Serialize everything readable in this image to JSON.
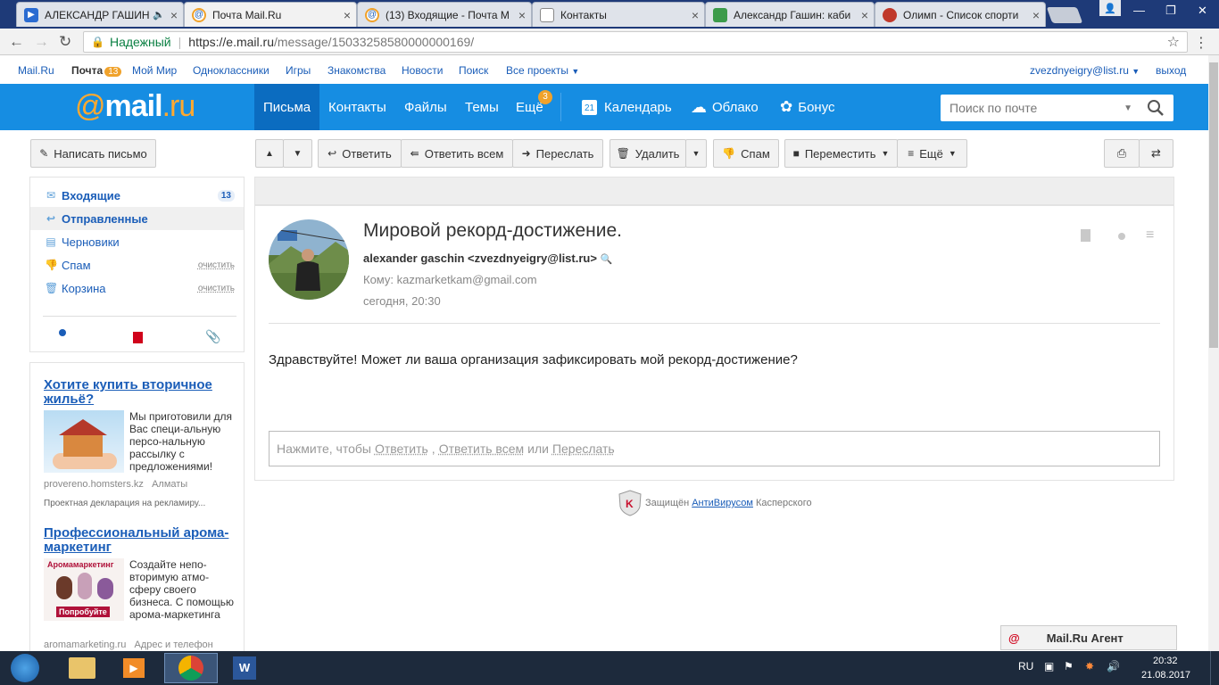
{
  "browser": {
    "tabs": [
      {
        "title": "АЛЕКСАНДР ГАШИН",
        "favicon": "play-icon"
      },
      {
        "title": "Почта Mail.Ru",
        "favicon": "mail-ru-icon"
      },
      {
        "title": "(13) Входящие - Почта М",
        "favicon": "mail-ru-icon"
      },
      {
        "title": "Контакты",
        "favicon": "page-icon"
      },
      {
        "title": "Александр Гашин: каби",
        "favicon": "sheet-icon"
      },
      {
        "title": "Олимп - Список спорти",
        "favicon": "olymp-icon"
      }
    ],
    "close_glyph": "×",
    "secure_label": "Надежный",
    "url_host": "https://e.mail.ru",
    "url_path": "/message/15033258580000000169/"
  },
  "portal": {
    "links": [
      "Mail.Ru",
      "Почта",
      "Мой Мир",
      "Одноклассники",
      "Игры",
      "Знакомства",
      "Новости",
      "Поиск",
      "Все проекты"
    ],
    "mail_count": "13",
    "user": "zvezdnyeigry@list.ru",
    "logout": "выход"
  },
  "header": {
    "logo_at": "@",
    "logo_mail": "mail",
    "logo_ru": ".ru",
    "nav": [
      "Письма",
      "Контакты",
      "Файлы",
      "Темы",
      "Ещё"
    ],
    "more_badge": "3",
    "calendar": "Календарь",
    "calendar_day": "21",
    "cloud": "Облако",
    "bonus": "Бонус",
    "search_placeholder": "Поиск по почте"
  },
  "toolbar": {
    "compose": "Написать письмо",
    "reply": "Ответить",
    "reply_all": "Ответить всем",
    "forward": "Переслать",
    "delete": "Удалить",
    "spam": "Спам",
    "move": "Переместить",
    "more": "Ещё"
  },
  "folders": [
    {
      "name": "Входящие",
      "count": "13"
    },
    {
      "name": "Отправленные"
    },
    {
      "name": "Черновики"
    },
    {
      "name": "Спам",
      "action": "очистить"
    },
    {
      "name": "Корзина",
      "action": "очистить"
    }
  ],
  "ads": [
    {
      "title": "Хотите купить вторичное жильё?",
      "text": "Мы приготовили для Вас специ-альную персо-нальную рассылку с предложениями!",
      "domain": "provereno.homsters.kz",
      "location": "Алматы",
      "note": "Проектная декларация на рекламиру..."
    },
    {
      "title": "Профессиональный арома-маркетинг",
      "image_caption": "Аромамаркетинг",
      "image_button": "Попробуйте",
      "text": "Создайте непо-вторимую атмо-сферу своего бизнеса. С помощью арома-маркетинга",
      "domain": "aromamarketing.ru",
      "location": "Адрес и телефон"
    }
  ],
  "message": {
    "subject": "Мировой рекорд-достижение.",
    "from": "alexander gaschin <zvezdnyeigry@list.ru>",
    "to": "Кому: kazmarketkam@gmail.com",
    "date": "сегодня, 20:30",
    "body": "Здравствуйте! Может ли ваша организация зафиксировать мой рекорд-достижение?",
    "reply_prompt": "Нажмите, чтобы",
    "reply_link": "Ответить",
    "reply_all_link": "Ответить всем",
    "or": "или",
    "forward_link": "Переслать"
  },
  "kaspersky": {
    "prefix": "Защищён",
    "link": "АнтиВирусом",
    "suffix": "Касперского"
  },
  "agent": "Mail.Ru Агент",
  "taskbar": {
    "lang": "RU",
    "time": "20:32",
    "date": "21.08.2017"
  },
  "colors": {
    "header_blue": "#168de2",
    "active_nav": "#0b6cc0",
    "logo_orange": "#ffa930",
    "badge_orange": "#f0a22b",
    "link_blue": "#1a5db8"
  }
}
